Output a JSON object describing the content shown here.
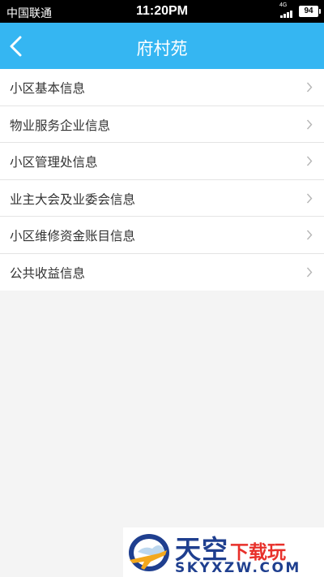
{
  "status_bar": {
    "carrier": "中国联通",
    "time": "11:20PM",
    "network": "4G",
    "battery": "94"
  },
  "header": {
    "title": "府村苑",
    "back_icon": "chevron-left-icon"
  },
  "menu": {
    "items": [
      {
        "label": "小区基本信息"
      },
      {
        "label": "物业服务企业信息"
      },
      {
        "label": "小区管理处信息"
      },
      {
        "label": "业主大会及业委会信息"
      },
      {
        "label": "小区维修资金账目信息"
      },
      {
        "label": "公共收益信息"
      }
    ]
  },
  "watermark": {
    "name": "天空",
    "tag": "下载玩",
    "url": "SKYXZW.COM"
  },
  "colors": {
    "nav_bar": "#35b6f2",
    "background": "#f4f4f4",
    "watermark_blue": "#1f3f8f",
    "watermark_red": "#e8302a"
  }
}
